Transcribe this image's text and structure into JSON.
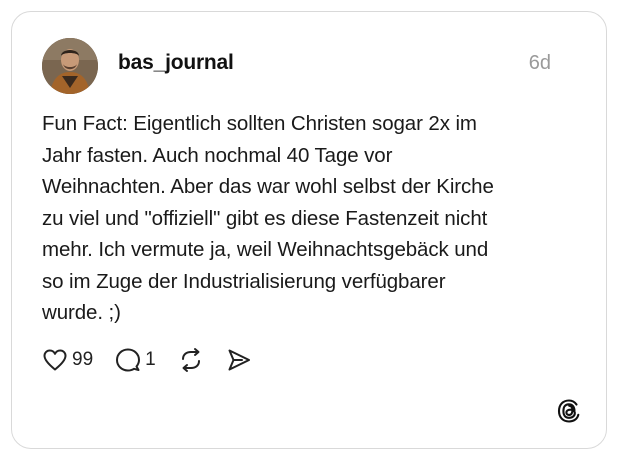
{
  "post": {
    "username": "bas_journal",
    "timestamp": "6d",
    "text": "Fun Fact: Eigentlich sollten Christen sogar 2x im\nJahr fasten. Auch nochmal 40 Tage vor\nWeihnachten. Aber das war wohl selbst der Kirche\nzu viel und \"offiziell\" gibt es diese Fastenzeit nicht\nmehr. Ich vermute ja, weil Weihnachtsgebäck und\nso im Zuge der Industrialisierung verfügbarer\nwurde. ;)",
    "likes": "99",
    "replies": "1"
  },
  "icons": {
    "like": "heart-icon",
    "reply": "comment-bubble-icon",
    "repost": "repost-icon",
    "share": "send-icon",
    "brand": "threads-logo-icon"
  },
  "colors": {
    "border": "#d9d9d9",
    "text": "#1a1a1a",
    "muted": "#9a9a9a",
    "background": "#ffffff"
  }
}
